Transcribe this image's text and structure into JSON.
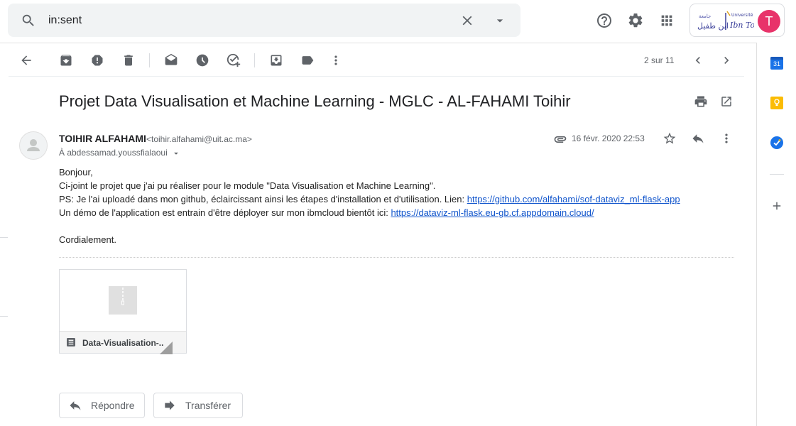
{
  "search": {
    "query": "in:sent"
  },
  "header": {
    "icons": [
      "search-icon",
      "clear-search-icon",
      "search-options-icon",
      "help-icon",
      "settings-icon",
      "apps-icon"
    ],
    "account_logo_text": "Université Ibn Tofail",
    "avatar_letter": "T",
    "avatar_color": "#e8336a"
  },
  "toolbar": {
    "icons": [
      "back-icon",
      "archive-icon",
      "report-spam-icon",
      "delete-icon",
      "mark-unread-icon",
      "snooze-icon",
      "add-task-icon",
      "move-to-icon",
      "label-icon",
      "more-icon"
    ],
    "pager": "2 sur 11"
  },
  "message": {
    "subject": "Projet Data Visualisation et Machine Learning - MGLC - AL-FAHAMI Toihir",
    "sender_name": "TOIHIR ALFAHAMI",
    "sender_email": "<toihir.alfahami@uit.ac.ma>",
    "recipient": "À abdessamad.youssfialaoui",
    "date": "16 févr. 2020 22:53",
    "body": {
      "line1": "Bonjour,",
      "line2": "Ci-joint le projet que j'ai pu réaliser pour le module \"Data Visualisation et Machine Learning\".",
      "line3_text": "PS: Je l'ai uploadé dans mon github, éclaircissant ainsi les étapes d'installation et d'utilisation. Lien: ",
      "line3_link": "https://github.com/alfahami/sof-dataviz_ml-flask-app",
      "line4_text": "Un démo de l'application est entrain d'être déployer sur mon ibmcloud bientôt ici: ",
      "line4_link": "https://dataviz-ml-flask.eu-gb.cf.appdomain.cloud/",
      "closing": "Cordialement."
    },
    "attachment": {
      "name": "Data-Visualisation-..."
    }
  },
  "actions": {
    "reply_label": "Répondre",
    "forward_label": "Transférer"
  },
  "side_panel": {
    "calendar_day": "31",
    "icons": [
      "calendar-icon",
      "keep-icon",
      "tasks-icon",
      "add-addon-icon"
    ]
  },
  "colors": {
    "link": "#1155cc",
    "accent_blue": "#1a73e8",
    "keep_yellow": "#fbbc04"
  }
}
